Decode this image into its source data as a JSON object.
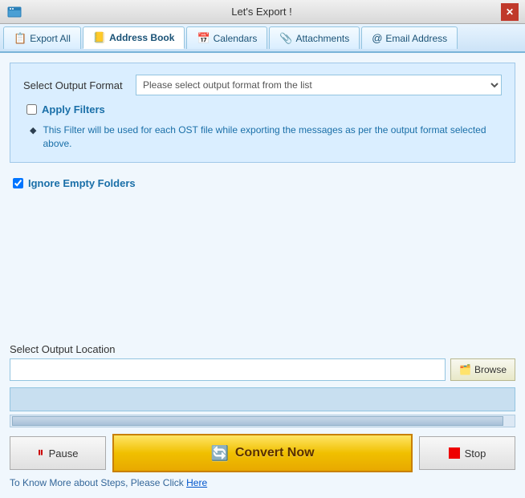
{
  "titleBar": {
    "title": "Let's Export !",
    "closeLabel": "✕"
  },
  "tabs": [
    {
      "id": "export-all",
      "label": "Export All",
      "icon": "📋",
      "active": false
    },
    {
      "id": "address-book",
      "label": "Address Book",
      "icon": "📒",
      "active": true
    },
    {
      "id": "calendars",
      "label": "Calendars",
      "icon": "📅",
      "active": false
    },
    {
      "id": "attachments",
      "label": "Attachments",
      "icon": "📎",
      "active": false
    },
    {
      "id": "email-address",
      "label": "Email Address",
      "icon": "@",
      "active": false
    }
  ],
  "formatSection": {
    "label": "Select Output Format",
    "selectPlaceholder": "Please select output format from the list",
    "filterCheckboxChecked": false,
    "filterLabel": "Apply Filters",
    "filterInfoText": "This Filter will be used for each OST file while exporting the messages as per the output format selected above."
  },
  "ignoreEmptyFolders": {
    "checked": true,
    "label": "Ignore Empty Folders"
  },
  "locationSection": {
    "label": "Select Output Location",
    "inputValue": "",
    "inputPlaceholder": "",
    "browseLabel": "Browse"
  },
  "actionBar": {
    "pauseLabel": "Pause",
    "convertLabel": "Convert Now",
    "stopLabel": "Stop"
  },
  "footer": {
    "text": "To Know More about Steps, Please Click ",
    "linkText": "Here"
  }
}
